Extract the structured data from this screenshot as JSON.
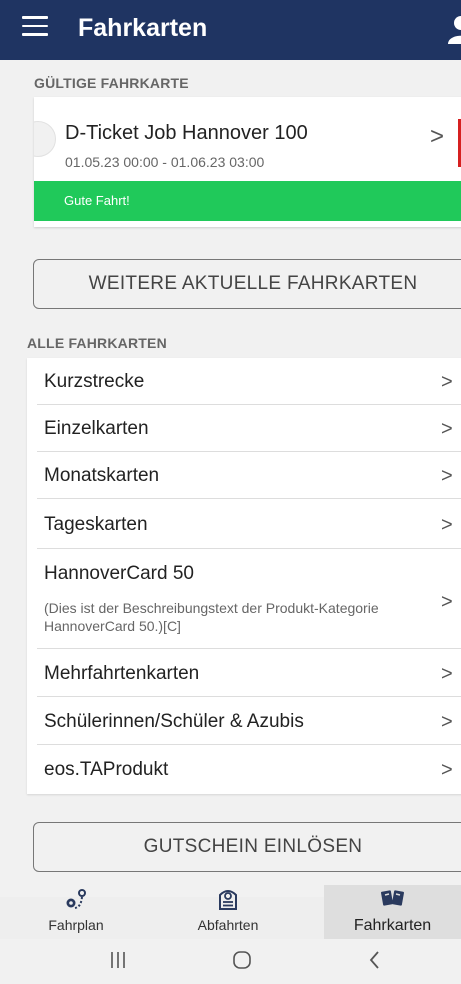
{
  "header": {
    "title": "Fahrkarten",
    "icons": {
      "menu": "hamburger-menu-icon",
      "account": "user-icon"
    },
    "colors": {
      "background": "#1f3462",
      "text": "#ffffff"
    }
  },
  "valid_ticket": {
    "section_title": "GÜLTIGE FAHRKARTE",
    "name": "D-Ticket Job Hannover 100",
    "validity": "01.05.23 00:00  - 01.06.23 03:00",
    "status": "Gute Fahrt!",
    "colors": {
      "status_background": "#20c95a",
      "marker": "#d62020"
    }
  },
  "more_tickets_button": "WEITERE AKTUELLE FAHRKARTEN",
  "all_tickets": {
    "section_title": "ALLE FAHRKARTEN",
    "items": [
      {
        "label": "Kurzstrecke"
      },
      {
        "label": "Einzelkarten"
      },
      {
        "label": "Monatskarten"
      },
      {
        "label": "Tageskarten"
      },
      {
        "label": "HannoverCard 50",
        "description": "(Dies ist der Beschreibungstext der Produkt-Kategorie HannoverCard 50.)[C]"
      },
      {
        "label": "Mehrfahrtenkarten"
      },
      {
        "label": "Schülerinnen/Schüler & Azubis"
      },
      {
        "label": "eos.TAProdukt"
      }
    ]
  },
  "voucher_button": "GUTSCHEIN EINLÖSEN",
  "bottom_nav": {
    "tabs": [
      {
        "label": "Fahrplan",
        "icon": "route-pin-icon"
      },
      {
        "label": "Abfahrten",
        "icon": "departure-board-icon"
      },
      {
        "label": "Fahrkarten",
        "icon": "tickets-icon",
        "active": true
      }
    ]
  },
  "system_nav": {
    "icons": [
      "recent-apps-icon",
      "home-icon",
      "back-icon"
    ]
  }
}
